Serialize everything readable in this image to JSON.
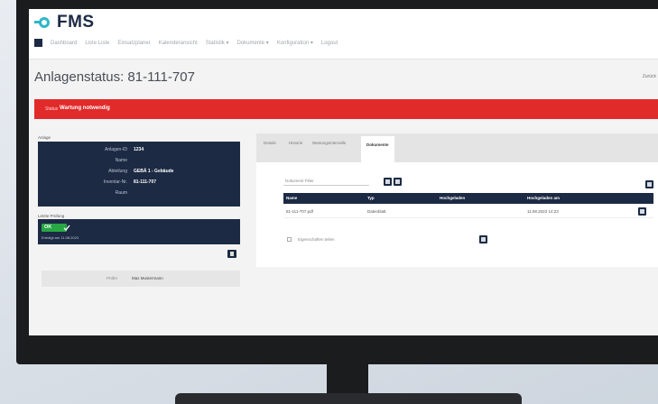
{
  "app": {
    "logo_text": "FMS",
    "brand_color": "#2fb7c9",
    "nav_color": "#1c2a44"
  },
  "nav": {
    "items": [
      "Dashboard",
      "Liste Liste",
      "Einsatzplaner",
      "Kalenderansicht",
      "Statistik ▾",
      "Dokumente ▾",
      "Konfiguration ▾",
      "Logout"
    ]
  },
  "page": {
    "title": "Anlagenstatus: 81-111-707",
    "top_right": "Zurück"
  },
  "status_banner": {
    "label": "Status",
    "value": "Wartung notwendig",
    "color": "#e12a2a"
  },
  "anlage": {
    "caption": "Anlage",
    "fields": [
      {
        "key": "Anlagen-ID",
        "value": "1234"
      },
      {
        "key": "Name",
        "value": ""
      },
      {
        "key": "Abteilung",
        "value": "GEBÄ 1 - Gebäude"
      },
      {
        "key": "Inventar-Nr.",
        "value": "81-111-707"
      },
      {
        "key": "Raum",
        "value": ""
      }
    ]
  },
  "status_box": {
    "caption": "Letzte Prüfung",
    "pill_text": "OK",
    "sub_text": "Erledigt am 11.08.2023"
  },
  "left_field": {
    "key": "Prüfer",
    "value": "Max Mustermann"
  },
  "tabs": [
    {
      "label": "Details",
      "active": false
    },
    {
      "label": "Historie",
      "active": false
    },
    {
      "label": "Wartungsintervalle",
      "active": false
    },
    {
      "label": "Dokumente",
      "active": true
    }
  ],
  "documents": {
    "filter_placeholder": "Dokument Filter",
    "columns": [
      "Name",
      "Typ",
      "Hochgeladen",
      "Hochgeladen am"
    ],
    "rows": [
      {
        "name": "81-111-707.pdf",
        "type": "Datenblatt",
        "uploaded_by": "",
        "uploaded_at": "11.08.2023 14:23"
      }
    ],
    "extra_label": "Eigenschaften teilen"
  }
}
